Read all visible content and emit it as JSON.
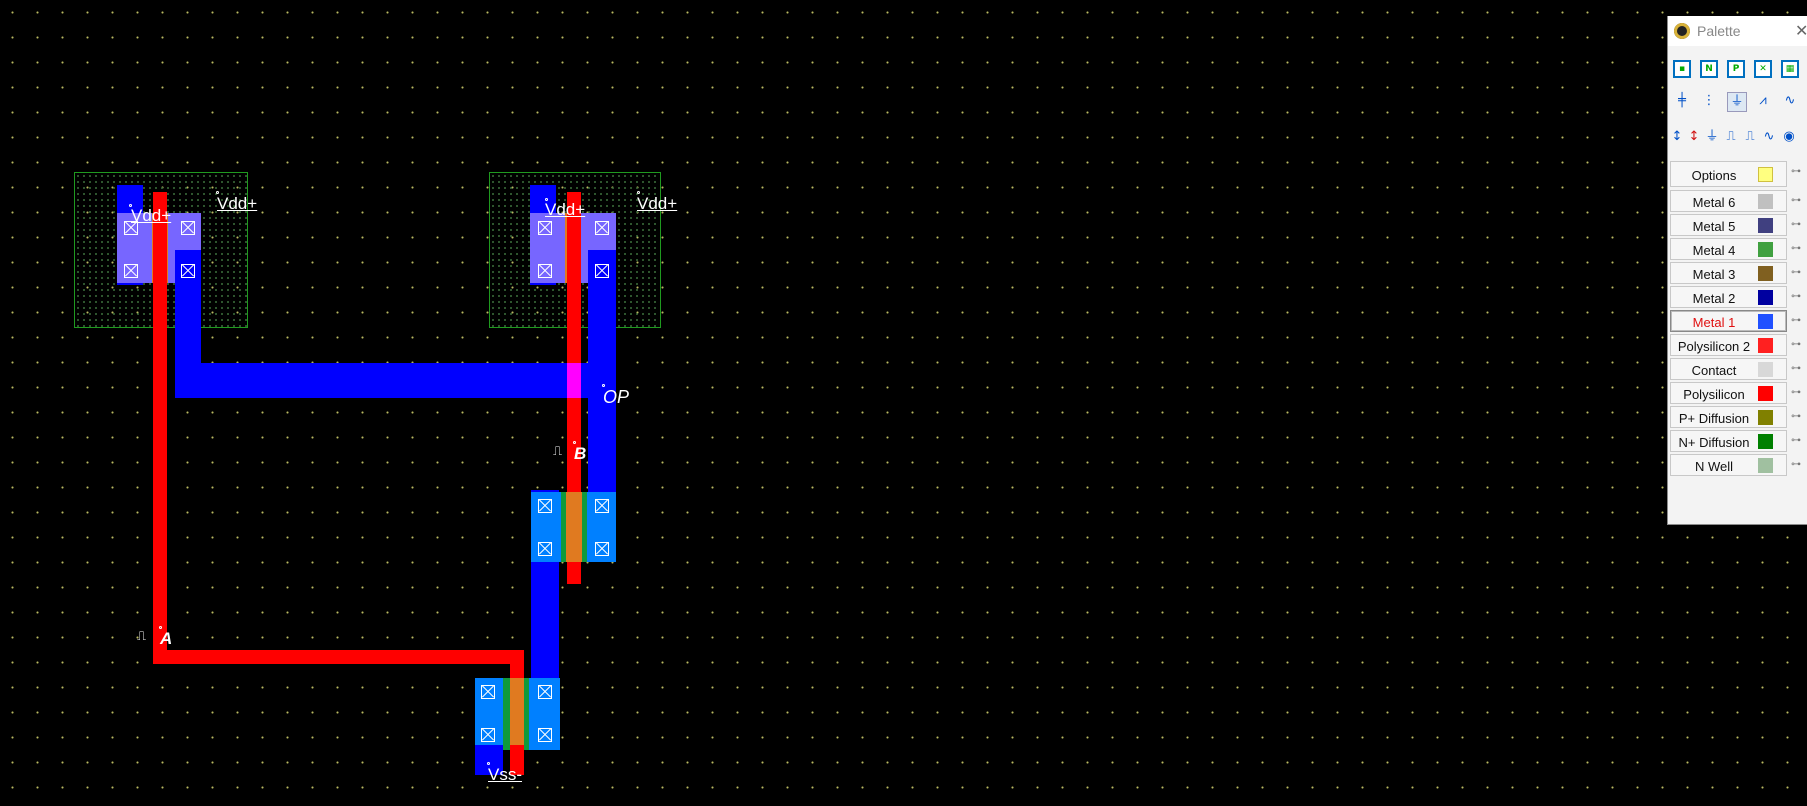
{
  "layout": {
    "labels": {
      "vdd1": "Vdd+",
      "vdd2": "Vdd+",
      "vdd3": "Vdd+",
      "vdd4": "Vdd+",
      "op": "OP",
      "input_a": "A",
      "input_b": "B",
      "vss": "Vss-"
    },
    "clock_glyph": "⎍"
  },
  "palette": {
    "title": "Palette",
    "close": "✕",
    "tool_icons_row1": [
      "pmos-icon",
      "nmos-icon",
      "pmos-body-icon",
      "nmos-body-icon",
      "transmission-gate-icon"
    ],
    "tool_icons_row2": [
      "capacitor-icon",
      "inductor-icon",
      "ground-icon",
      "resistor-icon",
      "diode-icon"
    ],
    "tool_icons_row3": [
      "vdd-source-icon",
      "vss-source-icon",
      "ground-node-icon",
      "clock-icon",
      "pulse-icon",
      "sine-icon",
      "visible-node-icon"
    ],
    "layers": [
      {
        "label": "Options",
        "swatch_color": "#ffff80"
      },
      {
        "label": "Metal 6",
        "swatch_color": "#c0c0c0"
      },
      {
        "label": "Metal 5",
        "swatch_color": "#404080"
      },
      {
        "label": "Metal 4",
        "swatch_color": "#40a040"
      },
      {
        "label": "Metal 3",
        "swatch_color": "#806020"
      },
      {
        "label": "Metal 2",
        "swatch_color": "#0000a0"
      },
      {
        "label": "Metal 1",
        "swatch_color": "#2050ff",
        "active": true
      },
      {
        "label": "Polysilicon 2",
        "swatch_color": "#ff2020"
      },
      {
        "label": "Contact",
        "swatch_color": "#d8d8d8"
      },
      {
        "label": "Polysilicon",
        "swatch_color": "#ff0000"
      },
      {
        "label": "P+ Diffusion",
        "swatch_color": "#808000"
      },
      {
        "label": "N+ Diffusion",
        "swatch_color": "#008000"
      },
      {
        "label": "N Well",
        "swatch_color": "#a0c0a0"
      }
    ],
    "pin_glyph": "⊶"
  }
}
